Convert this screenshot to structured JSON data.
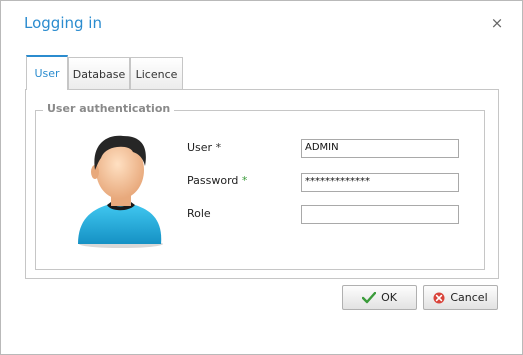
{
  "dialog": {
    "title": "Logging in",
    "close_glyph": "×"
  },
  "tabs": [
    {
      "label": "User",
      "active": true
    },
    {
      "label": "Database",
      "active": false
    },
    {
      "label": "Licence",
      "active": false
    }
  ],
  "group": {
    "legend": "User authentication"
  },
  "fields": {
    "user": {
      "label": "User",
      "required_mark": "*",
      "value": "ADMIN"
    },
    "password": {
      "label": "Password",
      "required_mark": "*",
      "value": "*************"
    },
    "role": {
      "label": "Role",
      "value": ""
    }
  },
  "buttons": {
    "ok_label": "OK",
    "cancel_label": "Cancel"
  },
  "colors": {
    "accent": "#2b8ccf",
    "ok_check": "#3a9b3a",
    "cancel_icon": "#d9443b"
  },
  "icons": {
    "close": "close-icon",
    "avatar": "user-avatar-icon",
    "ok": "checkmark-icon",
    "cancel": "cancel-icon"
  }
}
